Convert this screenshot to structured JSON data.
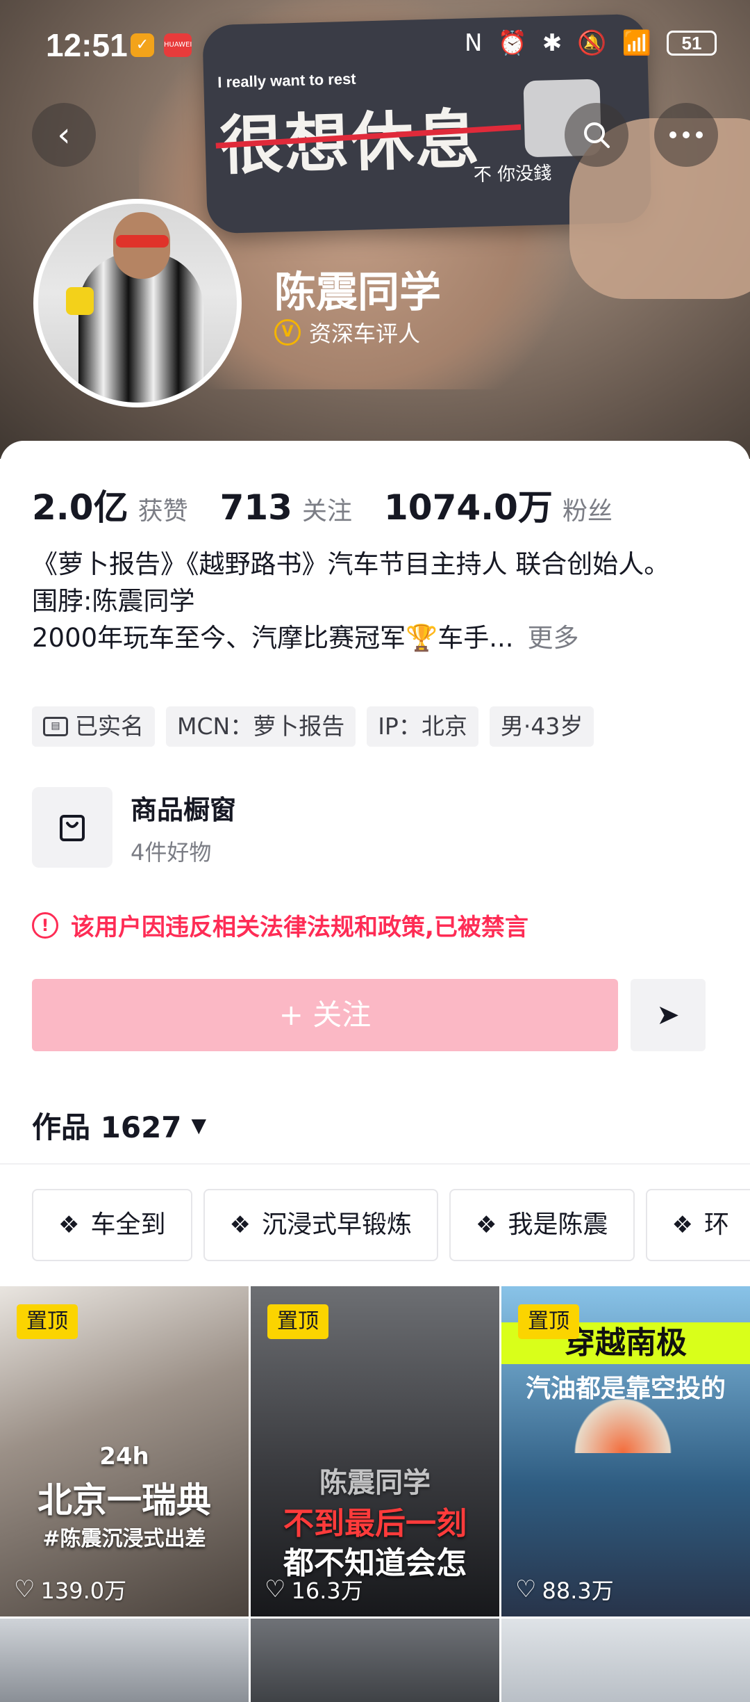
{
  "status_bar": {
    "time": "12:51",
    "app_icon_1": "✓",
    "app_icon_2": "HUAWEI",
    "icons": [
      "N",
      "⏰",
      "✱",
      "🔕",
      "📶"
    ],
    "battery": "51"
  },
  "header": {
    "phone_small_text": "I really want to rest",
    "phone_big_text": "很想休息",
    "phone_sub_text": "不 你没錢"
  },
  "profile": {
    "nickname": "陈震同学",
    "verified_label": "资深车评人",
    "verified_mark": "V",
    "stats": [
      {
        "value": "2.0亿",
        "label": "获赞"
      },
      {
        "value": "713",
        "label": "关注"
      },
      {
        "value": "1074.0万",
        "label": "粉丝"
      }
    ],
    "bio_lines": [
      "《萝卜报告》《越野路书》汽车节目主持人 联合创始人。",
      "围脖:陈震同学",
      "2000年玩车至今、汽摩比赛冠军🏆车手..."
    ],
    "bio_more": "更多",
    "tags": [
      "已实名",
      "MCN：萝卜报告",
      "IP：北京",
      "男·43岁"
    ]
  },
  "shop": {
    "title": "商品橱窗",
    "subtitle": "4件好物"
  },
  "ban_notice": "该用户因违反相关法律法规和政策,已被禁言",
  "actions": {
    "follow_label": "+ 关注",
    "share_icon": "➤"
  },
  "works": {
    "label": "作品 1627",
    "caret": "▼",
    "collections": [
      "车全到",
      "沉浸式早锻炼",
      "我是陈震",
      "环"
    ]
  },
  "videos": [
    {
      "pinned": "置顶",
      "likes": "139.0万",
      "caption_top": "24h",
      "caption_main": "北京一瑞典",
      "caption_sub": "#陈震沉浸式出差"
    },
    {
      "pinned": "置顶",
      "likes": "16.3万",
      "caption_top": "陈震同学",
      "caption_main": "不到最后一刻",
      "caption_sub": "都不知道会怎"
    },
    {
      "pinned": "置顶",
      "likes": "88.3万",
      "caption_top": "穿越南极",
      "caption_main": "汽油都是靠空投的",
      "caption_sub": ""
    }
  ],
  "colors": {
    "accent_pink": "#fe2c55",
    "follow_disabled": "#fbb8c5",
    "pin_yellow": "#fbd400",
    "verified_gold": "#f4b400"
  }
}
